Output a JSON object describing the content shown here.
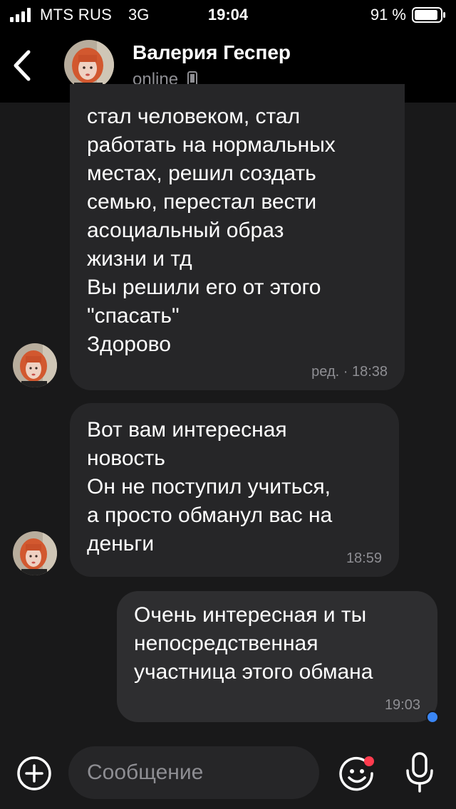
{
  "status_bar": {
    "carrier": "MTS RUS",
    "network": "3G",
    "time": "19:04",
    "battery_percent": "91 %",
    "battery_level": 0.91
  },
  "header": {
    "back_icon": "chevron-left-icon",
    "contact_name": "Валерия Геспер",
    "contact_status": "online",
    "status_icon": "phone-icon"
  },
  "messages": [
    {
      "direction": "incoming",
      "text": "стал человеком, стал\nработать на нормальных\nместах, решил создать\nсемью,  перестал вести\nасоциальный образ\nжизни и тд\nВы решили его от этого\n\"спасать\"\nЗдорово",
      "meta": "ред. · 18:38"
    },
    {
      "direction": "incoming",
      "text": "Вот вам интересная\nновость\nОн не поступил учиться,\nа просто обманул вас на\nденьги",
      "meta": "18:59"
    },
    {
      "direction": "outgoing",
      "text": "Очень интересная и ты\nнепосредственная\nучастница этого обмана",
      "meta": "19:03",
      "unread_color": "#3a86f5"
    }
  ],
  "composer": {
    "placeholder": "Сообщение",
    "attach_icon": "plus-circle-icon",
    "emoji_icon": "smiley-icon",
    "mic_icon": "microphone-icon"
  },
  "colors": {
    "background": "#19191a",
    "bar": "#000000",
    "bubble_incoming": "#262628",
    "bubble_outgoing": "#2e2e30",
    "secondary_text": "#8e8e93",
    "accent": "#3a86f5",
    "badge": "#ff3b4e"
  }
}
